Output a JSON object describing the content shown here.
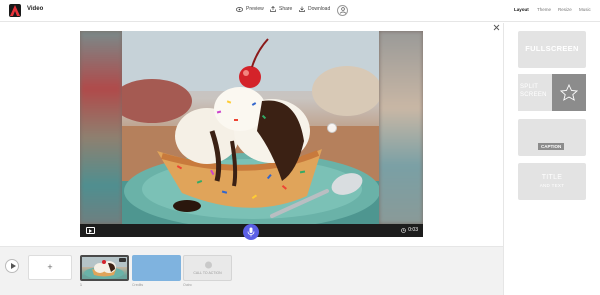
{
  "header": {
    "title": "Video",
    "tools": [
      {
        "label": "Preview",
        "icon": "eye-icon"
      },
      {
        "label": "Share",
        "icon": "upload-icon"
      },
      {
        "label": "Download",
        "icon": "download-icon"
      }
    ],
    "right_tabs": [
      {
        "label": "Layout",
        "active": true
      },
      {
        "label": "Theme",
        "active": false
      },
      {
        "label": "Resize",
        "active": false
      },
      {
        "label": "Music",
        "active": false
      }
    ]
  },
  "player": {
    "duration": "0:03"
  },
  "layouts": [
    {
      "name": "FULLSCREEN"
    },
    {
      "name_line1": "SPLIT",
      "name_line2": "SCREEN"
    },
    {
      "name": "CAPTION"
    },
    {
      "name": "TITLE",
      "sub": "AND TEXT"
    }
  ],
  "timeline": {
    "add_label": "+",
    "clips": [
      {
        "number": "1",
        "label": ""
      },
      {
        "label": "Credits"
      },
      {
        "label": "Outro",
        "text": "CALL TO ACTION"
      }
    ]
  },
  "colors": {
    "accent_mic": "#5b5fe6",
    "video_bar": "#1d1d1d"
  }
}
